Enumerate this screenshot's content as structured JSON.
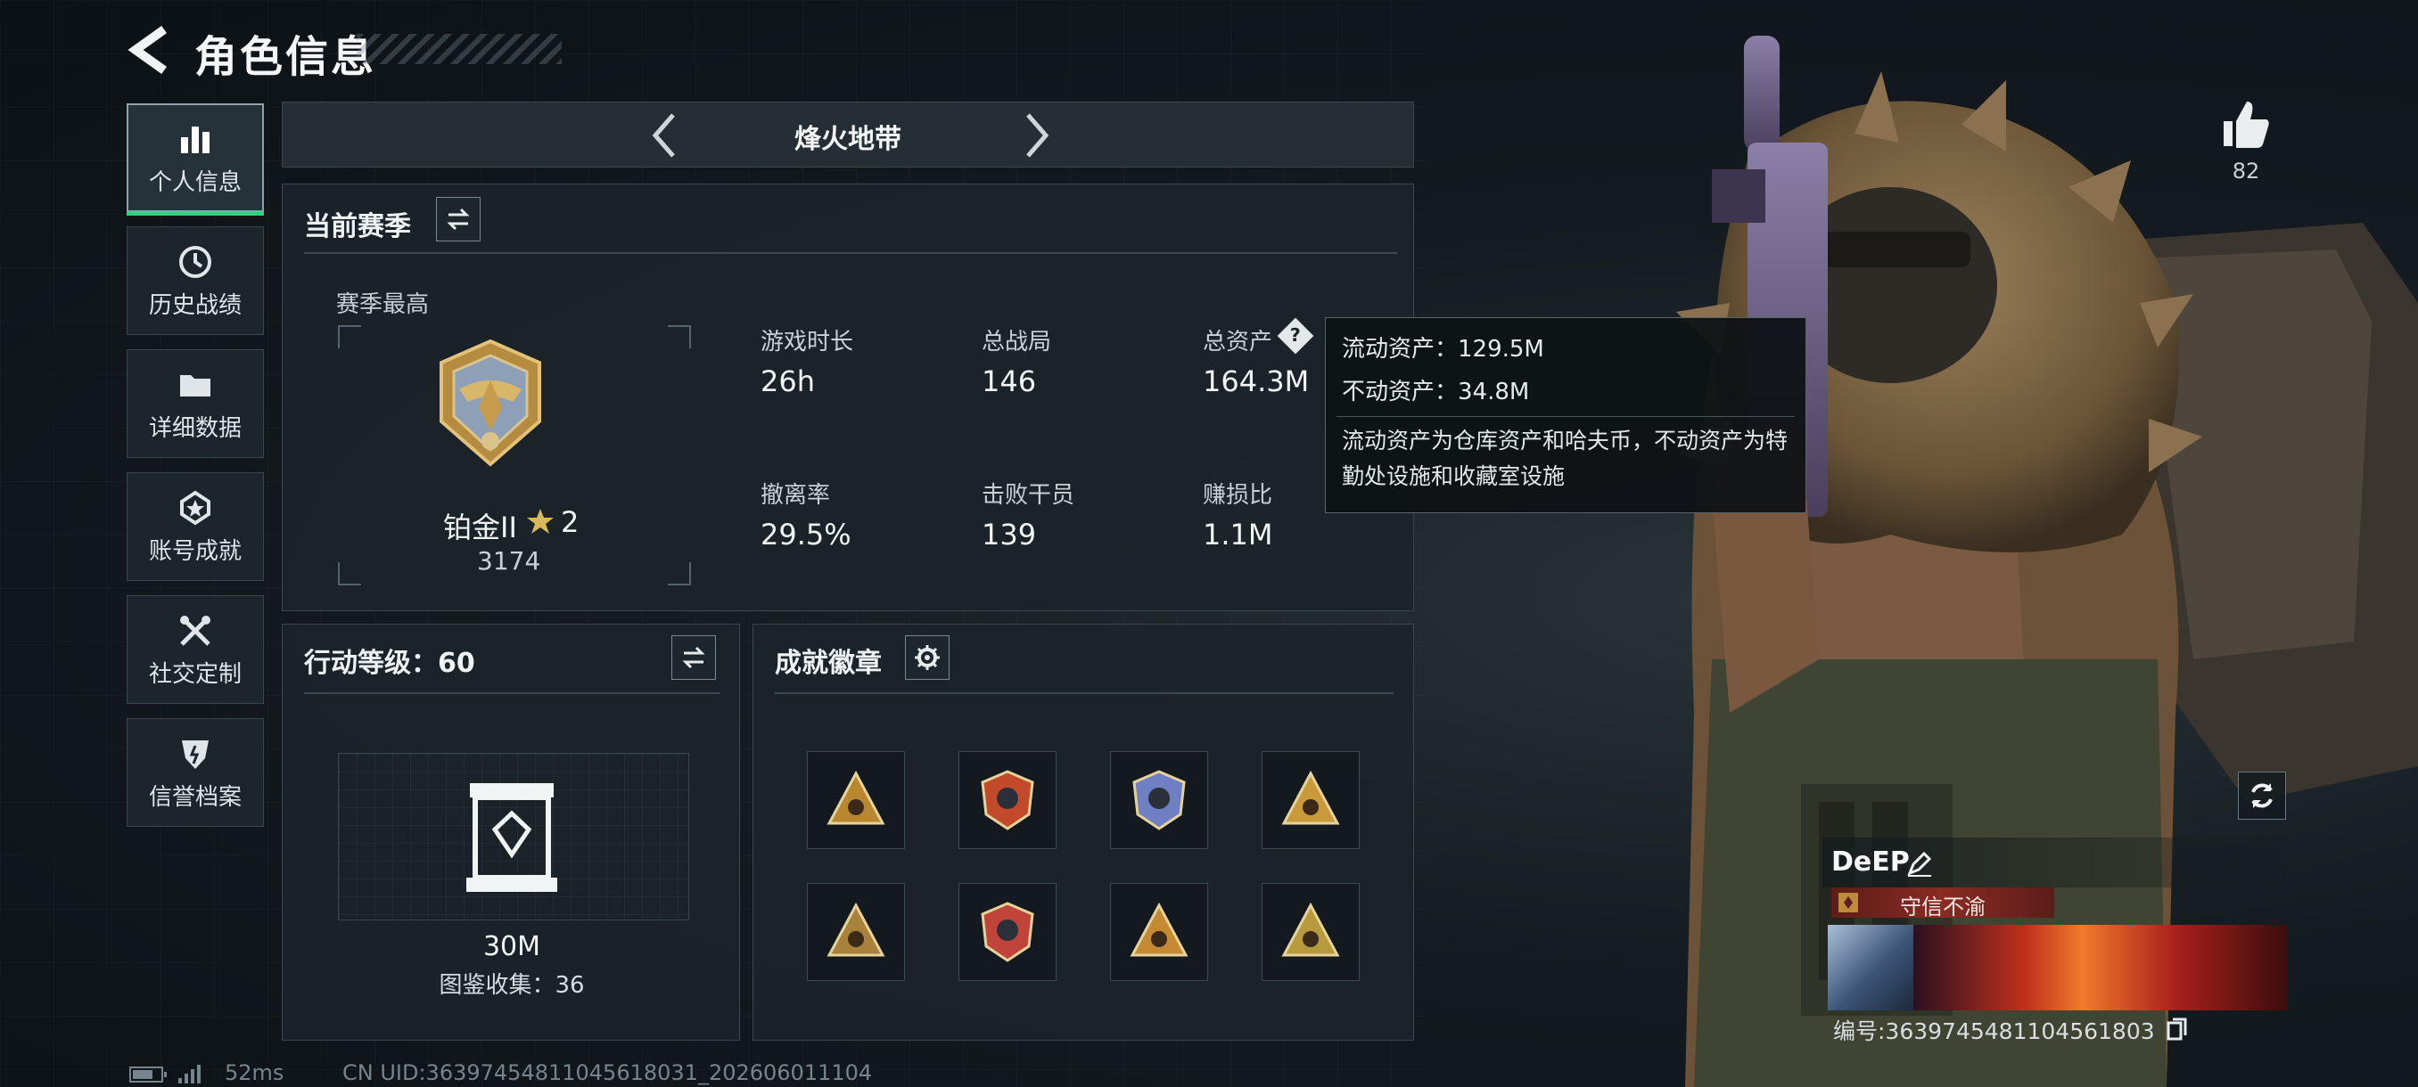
{
  "header": {
    "title": "角色信息"
  },
  "sidebar": {
    "items": [
      {
        "label": "个人信息",
        "icon": "bar-chart-icon",
        "active": true
      },
      {
        "label": "历史战绩",
        "icon": "history-icon",
        "active": false
      },
      {
        "label": "详细数据",
        "icon": "folder-icon",
        "active": false
      },
      {
        "label": "账号成就",
        "icon": "achievement-icon",
        "active": false
      },
      {
        "label": "社交定制",
        "icon": "tools-icon",
        "active": false
      },
      {
        "label": "信誉档案",
        "icon": "shield-icon",
        "active": false
      }
    ]
  },
  "mode": {
    "title": "烽火地带"
  },
  "season": {
    "title": "当前赛季",
    "highest_label": "赛季最高",
    "rank_name": "铂金II",
    "rank_stars": "2",
    "rank_score": "3174",
    "stats": [
      {
        "label": "游戏时长",
        "value": "26h"
      },
      {
        "label": "总战局",
        "value": "146"
      },
      {
        "label": "总资产",
        "value": "164.3M"
      },
      {
        "label": "撤离率",
        "value": "29.5%"
      },
      {
        "label": "击败干员",
        "value": "139"
      },
      {
        "label": "赚损比",
        "value": "1.1M"
      }
    ]
  },
  "tooltip": {
    "liquid": "流动资产：129.5M",
    "fixed": "不动资产：34.8M",
    "desc": "流动资产为仓库资产和哈夫币，不动资产为特勤处设施和收藏室设施"
  },
  "action_level": {
    "title": "行动等级：60",
    "value": "30M",
    "collection": "图鉴收集：36"
  },
  "achievements": {
    "title": "成就徽章",
    "badge_colors": [
      "#b8872f",
      "#c24a2a",
      "#6f7fc4",
      "#c99a3a",
      "#a8813d",
      "#c0443a",
      "#c68a35",
      "#b89a3e"
    ]
  },
  "likes": {
    "count": "82"
  },
  "player": {
    "name": "DeEP",
    "title": "守信不渝",
    "uid_label": "编号:3639745481104561803"
  },
  "footer": {
    "latency": "52ms",
    "uid": "CN UID:36397454811045618031_202606011104"
  }
}
